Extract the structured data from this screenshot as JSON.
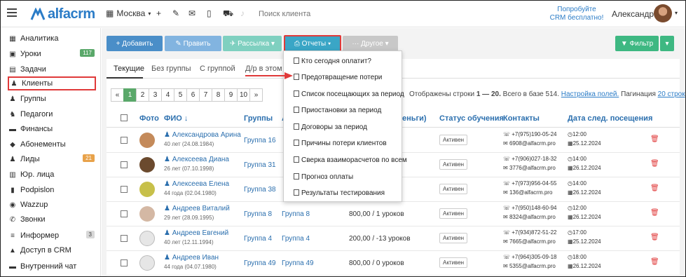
{
  "app": {
    "logo_text": "alfacrm",
    "city": "Москва",
    "search_placeholder": "Поиск клиента",
    "try_crm": "Попробуйте CRM бесплатно!",
    "user_name": "Александра"
  },
  "sidebar": {
    "items": [
      {
        "label": "Аналитика",
        "icon": "chart-icon"
      },
      {
        "label": "Уроки",
        "icon": "calendar-icon",
        "badge": "117",
        "badge_color": "#5aa86a"
      },
      {
        "label": "Задачи",
        "icon": "tasks-icon"
      },
      {
        "label": "Клиенты",
        "icon": "user-icon",
        "active": true
      },
      {
        "label": "Группы",
        "icon": "users-icon"
      },
      {
        "label": "Педагоги",
        "icon": "teacher-icon"
      },
      {
        "label": "Финансы",
        "icon": "money-icon"
      },
      {
        "label": "Абонементы",
        "icon": "tag-icon"
      },
      {
        "label": "Лиды",
        "icon": "lead-icon",
        "badge": "21",
        "badge_color": "#e8a24a"
      },
      {
        "label": "Юр. лица",
        "icon": "building-icon"
      },
      {
        "label": "Podpislon",
        "icon": "doc-icon"
      },
      {
        "label": "Wazzup",
        "icon": "whatsapp-icon"
      },
      {
        "label": "Звонки",
        "icon": "phone-icon"
      },
      {
        "label": "Информер",
        "icon": "list-icon",
        "badge": "3",
        "badge_color": "#d8d8d8"
      },
      {
        "label": "Доступ в CRM",
        "icon": "lock-icon"
      },
      {
        "label": "Внутренний чат",
        "icon": "chat-icon"
      }
    ]
  },
  "toolbar": {
    "add": "+ Добавить",
    "edit": "✎ Править",
    "mailing": "✈ Рассылка ▾",
    "reports": "⎙ Отчеты ▾",
    "other": "··· Другое ▾",
    "filter": "▼ Фильтр",
    "filter_more": "▾"
  },
  "tabs": [
    "Текущие",
    "Без группы",
    "С группой",
    "Д/р в этом м"
  ],
  "pagination": {
    "prev": "«",
    "pages": [
      "1",
      "2",
      "3",
      "4",
      "5",
      "6",
      "7",
      "8",
      "9",
      "10"
    ],
    "next": "»",
    "info_prefix": "Отображены строки",
    "info_range": "1 — 20.",
    "info_total": "Всего в базе 514.",
    "settings_link": "Настройка полей.",
    "pagination_label": "Пагинация",
    "per_page_link": "20 строк"
  },
  "table": {
    "headers": {
      "photo": "Фото",
      "name": "ФИО ↓",
      "groups": "Группы",
      "col_hidden": "А",
      "balance": "деньги)",
      "status": "Статус обучения",
      "contacts": "Контакты",
      "next_visit": "Дата след. посещения"
    },
    "rows": [
      {
        "name": "Александрова Арина",
        "age": "40 лет (24.08.1984)",
        "group": "Группа 16",
        "group2": "",
        "balance": "",
        "status": "Активен",
        "phone": "+7(975)190-05-24",
        "email": "6908@alfacrm.pro",
        "time": "12:00",
        "date": "25.12.2024",
        "photo": "#c48a5a"
      },
      {
        "name": "Алексеева Диана",
        "age": "26 лет (07.10.1998)",
        "group": "Группа 31",
        "group2": "",
        "balance": "",
        "status": "Активен",
        "phone": "+7(906)027-18-32",
        "email": "3776@alfacrm.pro",
        "time": "14:00",
        "date": "26.12.2024",
        "photo": "#6b4a2e"
      },
      {
        "name": "Алексеева Елена",
        "age": "44 года (02.04.1980)",
        "group": "Группа 38",
        "group2": "",
        "balance": "",
        "status": "Активен",
        "phone": "+7(973)956-04-55",
        "email": "136@alfacrm.pro",
        "time": "14:00",
        "date": "26.12.2024",
        "photo": "#c7c04a"
      },
      {
        "name": "Андреев Виталий",
        "age": "29 лет (28.09.1995)",
        "group": "Группа 8",
        "group2": "Группа 8",
        "balance": "800,00 / 1 уроков",
        "status": "Активен",
        "phone": "+7(950)148-60-94",
        "email": "8324@alfacrm.pro",
        "time": "12:00",
        "date": "26.12.2024",
        "photo": "#d4b8a4"
      },
      {
        "name": "Андреев Евгений",
        "age": "40 лет (12.11.1994)",
        "group": "Группа 4",
        "group2": "Группа 4",
        "balance": "200,00 / -13 уроков",
        "status": "Активен",
        "phone": "+7(934)872-51-22",
        "email": "7665@alfacrm.pro",
        "time": "17:00",
        "date": "25.12.2024",
        "photo": "#e6e6e6"
      },
      {
        "name": "Андреев Иван",
        "age": "44 года (04.07.1980)",
        "group": "Группа 49",
        "group2": "Группа 49",
        "balance": "800,00 / 0 уроков",
        "status": "Активен",
        "phone": "+7(964)305-09-18",
        "email": "5355@alfacrm.pro",
        "time": "18:00",
        "date": "26.12.2024",
        "photo": "#e6e6e6"
      }
    ]
  },
  "reports_menu": [
    "Кто сегодня оплатит?",
    "Предотвращение потери",
    "Список посещающих за период",
    "Приостановки за период",
    "Договоры за период",
    "Причины потери клиентов",
    "Сверка взаиморасчетов по всем",
    "Прогноз оплаты",
    "Результаты тестирования"
  ]
}
